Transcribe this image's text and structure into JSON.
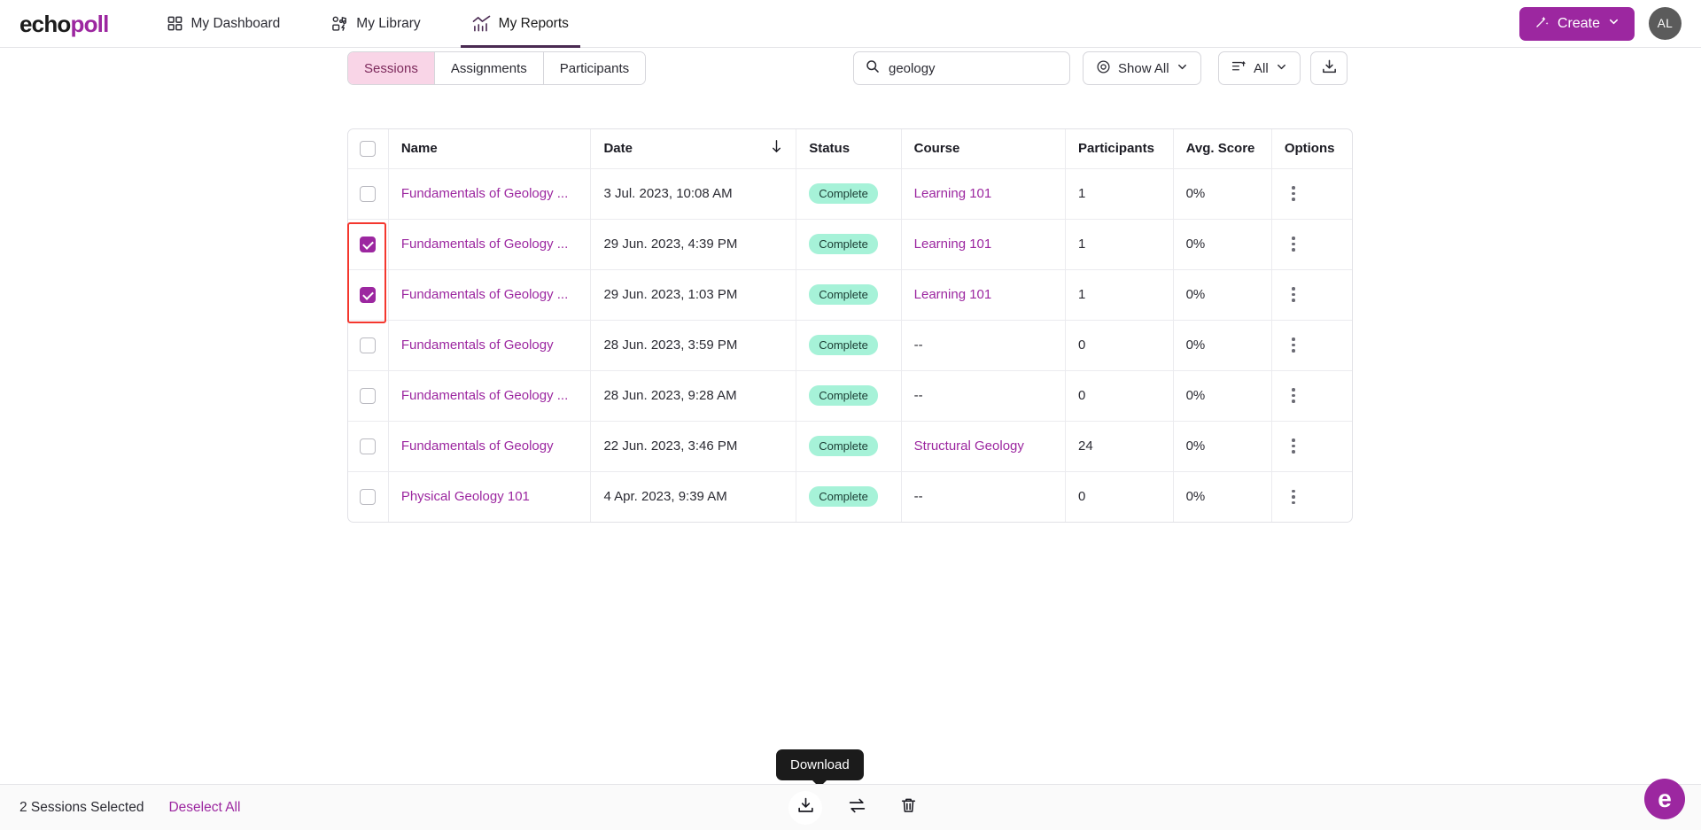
{
  "brand": {
    "name_part1": "echo",
    "name_part2": "poll",
    "accent": "#9c27a0"
  },
  "nav": {
    "items": [
      {
        "label": "My Dashboard",
        "icon": "grid-icon",
        "active": false
      },
      {
        "label": "My Library",
        "icon": "library-icon",
        "active": false
      },
      {
        "label": "My Reports",
        "icon": "chart-icon",
        "active": true
      }
    ],
    "create_label": "Create",
    "avatar_initials": "AL"
  },
  "toolbar": {
    "tabs": [
      {
        "label": "Sessions",
        "active": true
      },
      {
        "label": "Assignments",
        "active": false
      },
      {
        "label": "Participants",
        "active": false
      }
    ],
    "search": {
      "value": "geology",
      "placeholder": "Search"
    },
    "show_all_label": "Show All",
    "filter_label": "All",
    "download_label": "Download"
  },
  "table": {
    "columns": [
      "",
      "Name",
      "Date",
      "Status",
      "Course",
      "Participants",
      "Avg. Score",
      "Options"
    ],
    "sort_column": "Date",
    "sort_direction": "descending",
    "header_checkbox_checked": false,
    "rows": [
      {
        "checked": false,
        "name": "Fundamentals of Geology ...",
        "date": "3 Jul. 2023, 10:08 AM",
        "status": "Complete",
        "course": "Learning 101",
        "course_is_link": true,
        "participants": "1",
        "score": "0%"
      },
      {
        "checked": true,
        "name": "Fundamentals of Geology ...",
        "date": "29 Jun. 2023, 4:39 PM",
        "status": "Complete",
        "course": "Learning 101",
        "course_is_link": true,
        "participants": "1",
        "score": "0%"
      },
      {
        "checked": true,
        "name": "Fundamentals of Geology ...",
        "date": "29 Jun. 2023, 1:03 PM",
        "status": "Complete",
        "course": "Learning 101",
        "course_is_link": true,
        "participants": "1",
        "score": "0%"
      },
      {
        "checked": false,
        "name": "Fundamentals of Geology",
        "date": "28 Jun. 2023, 3:59 PM",
        "status": "Complete",
        "course": "--",
        "course_is_link": false,
        "participants": "0",
        "score": "0%"
      },
      {
        "checked": false,
        "name": "Fundamentals of Geology ...",
        "date": "28 Jun. 2023, 9:28 AM",
        "status": "Complete",
        "course": "--",
        "course_is_link": false,
        "participants": "0",
        "score": "0%"
      },
      {
        "checked": false,
        "name": "Fundamentals of Geology",
        "date": "22 Jun. 2023, 3:46 PM",
        "status": "Complete",
        "course": "Structural Geology",
        "course_is_link": true,
        "participants": "24",
        "score": "0%"
      },
      {
        "checked": false,
        "name": "Physical Geology 101",
        "date": "4 Apr. 2023, 9:39 AM",
        "status": "Complete",
        "course": "--",
        "course_is_link": false,
        "participants": "0",
        "score": "0%"
      }
    ]
  },
  "bottom_bar": {
    "selection_text": "2 Sessions Selected",
    "deselect_label": "Deselect All",
    "actions": [
      {
        "name": "download-action",
        "icon": "download-icon"
      },
      {
        "name": "move-action",
        "icon": "transfer-icon"
      },
      {
        "name": "delete-action",
        "icon": "trash-icon"
      }
    ],
    "tooltip_text": "Download"
  },
  "help_fab": {
    "glyph": "e"
  },
  "colors": {
    "brand_purple": "#9c27a0",
    "tab_active_bg": "#f9d5e7",
    "badge_green": "#a6f2d8",
    "annotation_red": "#f4372e"
  }
}
